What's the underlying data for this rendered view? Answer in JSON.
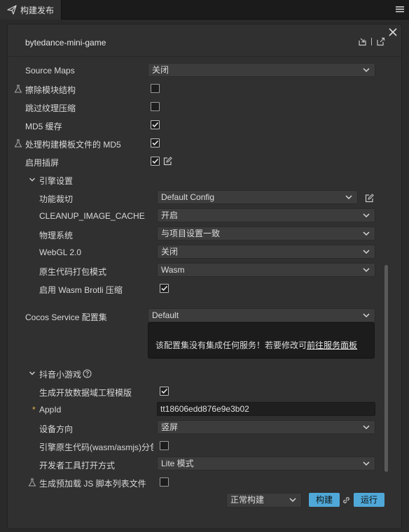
{
  "tab": {
    "label": "构建发布",
    "icon": "send-icon"
  },
  "panel": {
    "platform": "bytedance-mini-game",
    "header_icons": [
      "import-icon",
      "export-icon"
    ]
  },
  "options": {
    "source_maps": {
      "label": "Source Maps",
      "value": "关闭"
    },
    "strip_module": {
      "label": "擦除模块结构",
      "checked": false
    },
    "skip_texture_compress": {
      "label": "跳过纹理压缩",
      "checked": false
    },
    "md5_cache": {
      "label": "MD5 缓存",
      "checked": true
    },
    "md5_template": {
      "label": "处理构建模板文件的 MD5",
      "checked": true
    },
    "splash": {
      "label": "启用插屏",
      "checked": true
    }
  },
  "engine": {
    "title": "引擎设置",
    "feature_crop": {
      "label": "功能裁切",
      "value": "Default Config"
    },
    "cleanup_image_cache": {
      "label": "CLEANUP_IMAGE_CACHE",
      "value": "开启"
    },
    "physics": {
      "label": "物理系统",
      "value": "与项目设置一致"
    },
    "webgl2": {
      "label": "WebGL 2.0",
      "value": "关闭"
    },
    "native_code_mode": {
      "label": "原生代码打包模式",
      "value": "Wasm"
    },
    "wasm_brotli": {
      "label": "启用 Wasm Brotli 压缩",
      "checked": true
    }
  },
  "cocos_service": {
    "label": "Cocos Service 配置集",
    "value": "Default",
    "info_text": "该配置集没有集成任何服务！若要修改可",
    "info_link": "前往服务面板"
  },
  "douyin": {
    "title": "抖音小游戏",
    "open_data": {
      "label": "生成开放数据域工程模版",
      "checked": true
    },
    "appid": {
      "label": "AppId",
      "required_mark": "*",
      "value": "tt18606edd876e9e3b02"
    },
    "orientation": {
      "label": "设备方向",
      "value": "竖屏"
    },
    "separate_engine": {
      "label": "引擎原生代码(wasm/asmjs)分包",
      "checked": false
    },
    "devtools_mode": {
      "label": "开发者工具打开方式",
      "value": "Lite 模式"
    }
  },
  "preload_js": {
    "label": "生成预加载 JS 脚本列表文件",
    "checked": false
  },
  "footer": {
    "build_mode": "正常构建",
    "build_button": "构建",
    "run_button": "运行"
  },
  "colors": {
    "accent": "#4fa8d8",
    "panel_bg": "#303030",
    "field_bg": "#3c3c3c",
    "required": "#e6b14a"
  }
}
